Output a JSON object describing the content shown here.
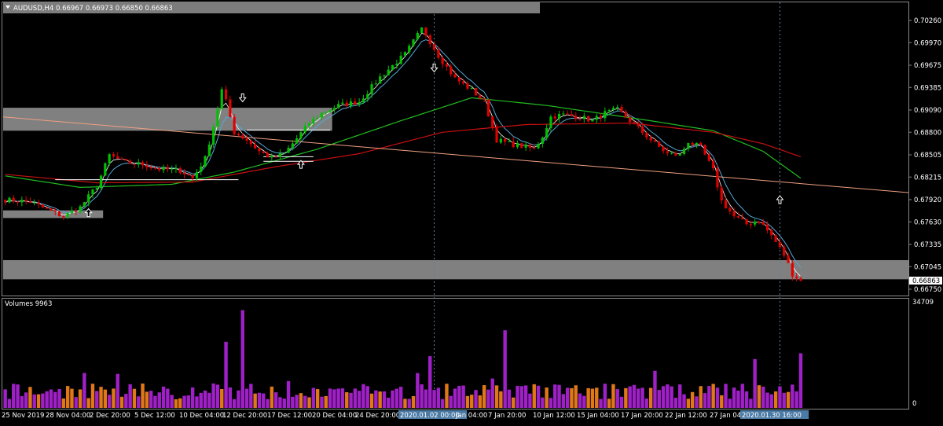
{
  "window": {
    "symbol_title": "AUDUSD,H4",
    "ohlc": "0.66967 0.66973 0.66850 0.66863"
  },
  "volume_panel": {
    "title": "Volumes 9963",
    "max_label": "34709",
    "min_label": "0"
  },
  "colors": {
    "background": "#000000",
    "bull_candle": "#00c000",
    "bear_candle": "#e00000",
    "zone": "#808080",
    "ma_fast": "#ffffff",
    "ma_blue": "#55a8d8",
    "ma_green": "#22bb22",
    "ma_red": "#c81010",
    "trendline": "#f0a080",
    "volume_purple": "#a020c8",
    "volume_orange": "#e07818",
    "grid_vertical": "#5a7fa8",
    "highlight_label": "#4b7aa5"
  },
  "chart_data": {
    "type": "candlestick",
    "symbol": "AUDUSD",
    "timeframe": "H4",
    "y_ticks": [
      "0.70260",
      "0.69970",
      "0.69675",
      "0.69385",
      "0.69090",
      "0.68800",
      "0.68505",
      "0.68215",
      "0.67920",
      "0.67630",
      "0.67335",
      "0.67045",
      "0.66750"
    ],
    "ylim": [
      0.6675,
      0.7026
    ],
    "current_price": "0.66863",
    "x_labels": [
      "25 Nov 2019",
      "28 Nov 04:00",
      "2 Dec 20:00",
      "5 Dec 12:00",
      "10 Dec 04:00",
      "12 Dec 20:00",
      "17 Dec 12:00",
      "20 Dec 04:00",
      "24 Dec 20:00",
      "2020.01.02 00:00",
      "Jan 04:00",
      "7 Jan 20:00",
      "10 Jan 12:00",
      "15 Jan 04:00",
      "17 Jan 20:00",
      "22 Jan 12:00",
      "27 Jan 04:",
      "2020.01.30 16:00"
    ],
    "highlighted_x_labels": [
      "2020.01.02 00:00",
      "2020.01.30 16:00"
    ],
    "price_path": [
      [
        0,
        0.6792
      ],
      [
        6,
        0.6789
      ],
      [
        10,
        0.6779
      ],
      [
        14,
        0.677
      ],
      [
        18,
        0.6782
      ],
      [
        22,
        0.681
      ],
      [
        25,
        0.685
      ],
      [
        29,
        0.684
      ],
      [
        33,
        0.6838
      ],
      [
        37,
        0.6832
      ],
      [
        42,
        0.683
      ],
      [
        45,
        0.682
      ],
      [
        48,
        0.6846
      ],
      [
        50,
        0.6888
      ],
      [
        52,
        0.6935
      ],
      [
        53,
        0.692
      ],
      [
        55,
        0.688
      ],
      [
        58,
        0.687
      ],
      [
        61,
        0.6855
      ],
      [
        64,
        0.6846
      ],
      [
        67,
        0.6852
      ],
      [
        70,
        0.6872
      ],
      [
        73,
        0.6892
      ],
      [
        76,
        0.6905
      ],
      [
        80,
        0.6915
      ],
      [
        85,
        0.692
      ],
      [
        90,
        0.6952
      ],
      [
        96,
        0.6982
      ],
      [
        100,
        0.7015
      ],
      [
        101,
        0.7008
      ],
      [
        104,
        0.698
      ],
      [
        108,
        0.695
      ],
      [
        112,
        0.6935
      ],
      [
        115,
        0.692
      ],
      [
        118,
        0.687
      ],
      [
        121,
        0.6865
      ],
      [
        124,
        0.6862
      ],
      [
        127,
        0.6858
      ],
      [
        129,
        0.6875
      ],
      [
        131,
        0.69
      ],
      [
        134,
        0.6903
      ],
      [
        138,
        0.69
      ],
      [
        141,
        0.6895
      ],
      [
        144,
        0.6905
      ],
      [
        147,
        0.691
      ],
      [
        150,
        0.6895
      ],
      [
        153,
        0.688
      ],
      [
        156,
        0.6865
      ],
      [
        159,
        0.6852
      ],
      [
        162,
        0.685
      ],
      [
        164,
        0.6868
      ],
      [
        167,
        0.686
      ],
      [
        170,
        0.683
      ],
      [
        172,
        0.679
      ],
      [
        175,
        0.677
      ],
      [
        178,
        0.676
      ],
      [
        181,
        0.6765
      ],
      [
        184,
        0.6745
      ],
      [
        187,
        0.672
      ],
      [
        189,
        0.6695
      ],
      [
        191,
        0.6686
      ]
    ],
    "moving_averages": [
      {
        "color": "green",
        "points": [
          [
            0,
            0.6823
          ],
          [
            18,
            0.6808
          ],
          [
            40,
            0.6812
          ],
          [
            55,
            0.6828
          ],
          [
            75,
            0.6858
          ],
          [
            95,
            0.6895
          ],
          [
            112,
            0.6925
          ],
          [
            130,
            0.6915
          ],
          [
            155,
            0.6895
          ],
          [
            170,
            0.6882
          ],
          [
            182,
            0.6855
          ],
          [
            191,
            0.682
          ]
        ]
      },
      {
        "color": "red",
        "points": [
          [
            0,
            0.6825
          ],
          [
            22,
            0.6814
          ],
          [
            45,
            0.6815
          ],
          [
            65,
            0.6835
          ],
          [
            85,
            0.6852
          ],
          [
            105,
            0.688
          ],
          [
            125,
            0.689
          ],
          [
            150,
            0.6892
          ],
          [
            170,
            0.688
          ],
          [
            182,
            0.6865
          ],
          [
            191,
            0.6848
          ]
        ]
      }
    ],
    "trendline": {
      "from": [
        0,
        0.69
      ],
      "to": [
        220,
        0.68
      ]
    },
    "zones": [
      {
        "from": 0,
        "to": 23,
        "low": 0.6768,
        "high": 0.6778
      },
      {
        "from": 0,
        "to": 78,
        "low": 0.6882,
        "high": 0.6912
      },
      {
        "from": 0,
        "to": 220,
        "low": 0.6688,
        "high": 0.6713
      }
    ],
    "support_lines": [
      {
        "from": 12,
        "to": 56,
        "price": 0.6818
      },
      {
        "from": 58,
        "to": 78,
        "price": 0.6883
      },
      {
        "from": 62,
        "to": 74,
        "price": 0.6848
      },
      {
        "from": 62,
        "to": 74,
        "price": 0.6842
      }
    ],
    "arrows": [
      {
        "bar": 20,
        "price": 0.6775,
        "dir": "up"
      },
      {
        "bar": 57,
        "price": 0.6925,
        "dir": "down"
      },
      {
        "bar": 71,
        "price": 0.6838,
        "dir": "up"
      },
      {
        "bar": 103,
        "price": 0.6964,
        "dir": "down"
      },
      {
        "bar": 186,
        "price": 0.6792,
        "dir": "up"
      }
    ],
    "vertical_markers": [
      103,
      186
    ],
    "volume": {
      "max": 34709,
      "min": 0
    }
  }
}
